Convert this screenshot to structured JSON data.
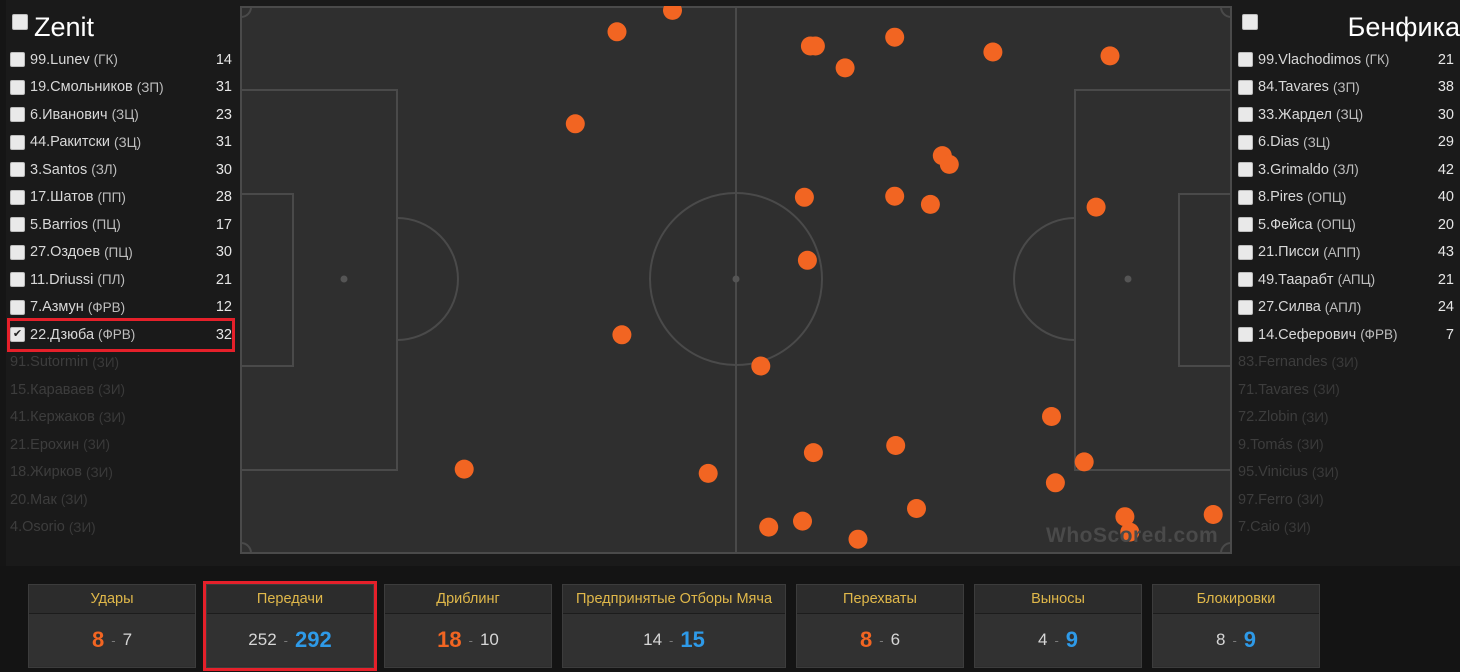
{
  "home_team": {
    "name": "Zenit",
    "players": [
      {
        "name": "99.Lunev",
        "pos": "(ГК)",
        "count": "14",
        "checked": false
      },
      {
        "name": "19.Смольников",
        "pos": "(ЗП)",
        "count": "31",
        "checked": false
      },
      {
        "name": "6.Иванович",
        "pos": "(ЗЦ)",
        "count": "23",
        "checked": false
      },
      {
        "name": "44.Ракитски",
        "pos": "(ЗЦ)",
        "count": "31",
        "checked": false
      },
      {
        "name": "3.Santos",
        "pos": "(ЗЛ)",
        "count": "30",
        "checked": false
      },
      {
        "name": "17.Шатов",
        "pos": "(ПП)",
        "count": "28",
        "checked": false
      },
      {
        "name": "5.Barrios",
        "pos": "(ПЦ)",
        "count": "17",
        "checked": false
      },
      {
        "name": "27.Оздоев",
        "pos": "(ПЦ)",
        "count": "30",
        "checked": false
      },
      {
        "name": "11.Driussi",
        "pos": "(ПЛ)",
        "count": "21",
        "checked": false
      },
      {
        "name": "7.Азмун",
        "pos": "(ФРВ)",
        "count": "12",
        "checked": false
      },
      {
        "name": "22.Дзюба",
        "pos": "(ФРВ)",
        "count": "32",
        "checked": true
      }
    ],
    "subs": [
      {
        "name": "91.Sutormin",
        "pos": "(ЗИ)"
      },
      {
        "name": "15.Караваев",
        "pos": "(ЗИ)"
      },
      {
        "name": "41.Кержаков",
        "pos": "(ЗИ)"
      },
      {
        "name": "21.Ерохин",
        "pos": "(ЗИ)"
      },
      {
        "name": "18.Жирков",
        "pos": "(ЗИ)"
      },
      {
        "name": "20.Мак",
        "pos": "(ЗИ)"
      },
      {
        "name": "4.Osorio",
        "pos": "(ЗИ)"
      }
    ]
  },
  "away_team": {
    "name": "Бенфика",
    "players": [
      {
        "name": "99.Vlachodimos",
        "pos": "(ГК)",
        "count": "21"
      },
      {
        "name": "84.Tavares",
        "pos": "(ЗП)",
        "count": "38"
      },
      {
        "name": "33.Жардел",
        "pos": "(ЗЦ)",
        "count": "30"
      },
      {
        "name": "6.Dias",
        "pos": "(ЗЦ)",
        "count": "29"
      },
      {
        "name": "3.Grimaldo",
        "pos": "(ЗЛ)",
        "count": "42"
      },
      {
        "name": "8.Pires",
        "pos": "(ОПЦ)",
        "count": "40"
      },
      {
        "name": "5.Фейса",
        "pos": "(ОПЦ)",
        "count": "20"
      },
      {
        "name": "21.Писси",
        "pos": "(АПП)",
        "count": "43"
      },
      {
        "name": "49.Таарабт",
        "pos": "(АПЦ)",
        "count": "21"
      },
      {
        "name": "27.Силва",
        "pos": "(АПЛ)",
        "count": "24"
      },
      {
        "name": "14.Сеферович",
        "pos": "(ФРВ)",
        "count": "7"
      }
    ],
    "subs": [
      {
        "name": "83.Fernandes",
        "pos": "(ЗИ)"
      },
      {
        "name": "71.Tavares",
        "pos": "(ЗИ)"
      },
      {
        "name": "72.Zlobin",
        "pos": "(ЗИ)"
      },
      {
        "name": "9.Tomás",
        "pos": "(ЗИ)"
      },
      {
        "name": "95.Vinicius",
        "pos": "(ЗИ)"
      },
      {
        "name": "97.Ferro",
        "pos": "(ЗИ)"
      },
      {
        "name": "7.Caio",
        "pos": "(ЗИ)"
      }
    ]
  },
  "watermark": "WhoScored.com",
  "pass_points": [
    [
      0.436,
      0.008
    ],
    [
      0.38,
      0.047
    ],
    [
      0.575,
      0.073
    ],
    [
      0.58,
      0.073
    ],
    [
      0.66,
      0.057
    ],
    [
      0.759,
      0.084
    ],
    [
      0.877,
      0.091
    ],
    [
      0.61,
      0.113
    ],
    [
      0.338,
      0.215
    ],
    [
      0.708,
      0.273
    ],
    [
      0.715,
      0.289
    ],
    [
      0.569,
      0.349
    ],
    [
      0.66,
      0.347
    ],
    [
      0.696,
      0.362
    ],
    [
      0.863,
      0.367
    ],
    [
      0.572,
      0.464
    ],
    [
      0.385,
      0.6
    ],
    [
      0.525,
      0.657
    ],
    [
      0.818,
      0.749
    ],
    [
      0.226,
      0.845
    ],
    [
      0.472,
      0.853
    ],
    [
      0.578,
      0.815
    ],
    [
      0.661,
      0.802
    ],
    [
      0.851,
      0.832
    ],
    [
      0.822,
      0.87
    ],
    [
      0.682,
      0.917
    ],
    [
      0.533,
      0.951
    ],
    [
      0.567,
      0.94
    ],
    [
      0.623,
      0.973
    ],
    [
      0.892,
      0.932
    ],
    [
      0.897,
      0.96
    ],
    [
      0.981,
      0.928
    ]
  ],
  "colors": {
    "marker": "#f26522",
    "home_accent": "#f26522",
    "away_accent": "#2e9ae8",
    "label": "#e0b84a",
    "highlight": "#e5202a"
  },
  "stats": [
    {
      "label": "Удары",
      "home": "8",
      "away": "7",
      "emph": "home",
      "selected": false
    },
    {
      "label": "Передачи",
      "home": "252",
      "away": "292",
      "emph": "away",
      "selected": true
    },
    {
      "label": "Дриблинг",
      "home": "18",
      "away": "10",
      "emph": "home",
      "selected": false
    },
    {
      "label": "Предпринятые Отборы Мяча",
      "home": "14",
      "away": "15",
      "emph": "away",
      "selected": false
    },
    {
      "label": "Перехваты",
      "home": "8",
      "away": "6",
      "emph": "home",
      "selected": false
    },
    {
      "label": "Выносы",
      "home": "4",
      "away": "9",
      "emph": "away",
      "selected": false
    },
    {
      "label": "Блокировки",
      "home": "8",
      "away": "9",
      "emph": "away",
      "selected": false
    }
  ]
}
